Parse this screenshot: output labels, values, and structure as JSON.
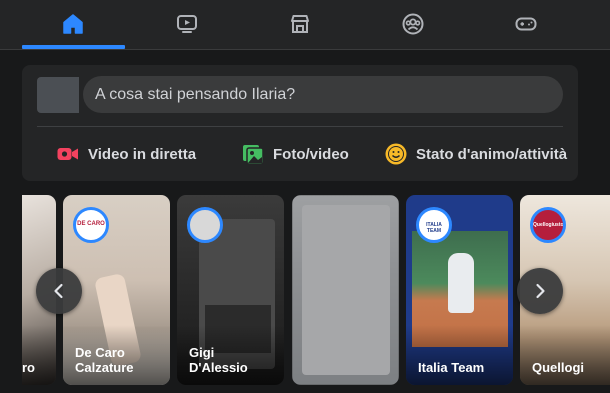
{
  "nav": {
    "tabs": [
      {
        "icon": "home-icon",
        "active": true
      },
      {
        "icon": "watch-video-icon",
        "active": false
      },
      {
        "icon": "marketplace-icon",
        "active": false
      },
      {
        "icon": "groups-icon",
        "active": false
      },
      {
        "icon": "gaming-icon",
        "active": false
      }
    ],
    "accent": "#2d88ff"
  },
  "composer": {
    "placeholder": "A cosa stai pensando Ilaria?",
    "actions": [
      {
        "label": "Video in diretta",
        "icon": "live-video-icon",
        "color": "#f3425f"
      },
      {
        "label": "Foto/video",
        "icon": "photo-video-icon",
        "color": "#45bd62"
      },
      {
        "label": "Stato d'animo/attività",
        "icon": "feeling-smiley-icon",
        "color": "#f7b928"
      }
    ]
  },
  "stories": [
    {
      "name": "ro"
    },
    {
      "name": "De Caro\nCalzature",
      "badge": "DE CARO"
    },
    {
      "name": "Gigi D'Alessio"
    },
    {
      "name": ""
    },
    {
      "name": "Italia Team",
      "badge": "ITALIA TEAM"
    },
    {
      "name": "Quellogi",
      "badge": "Quellogiusto"
    }
  ]
}
